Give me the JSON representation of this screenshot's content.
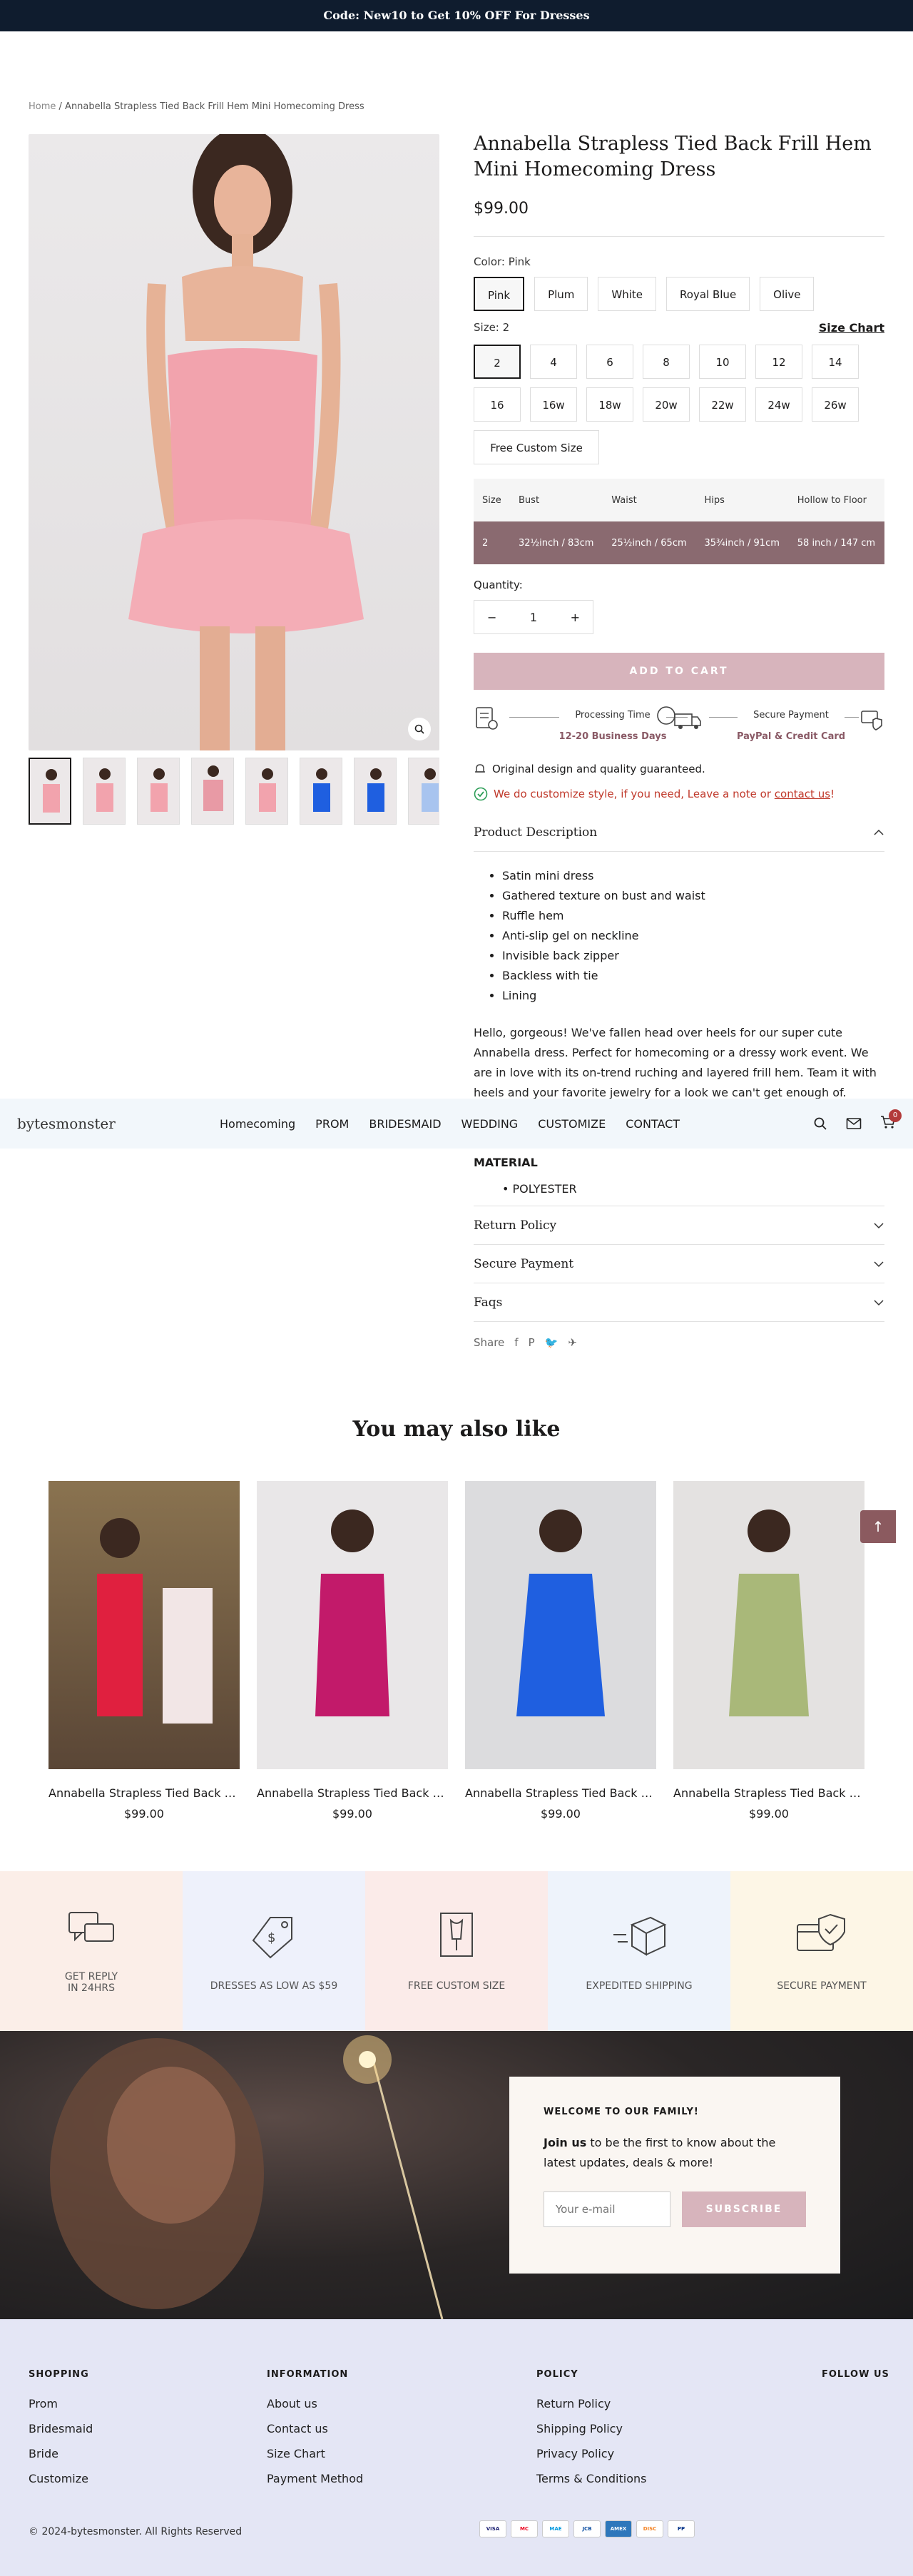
{
  "announcement": "Code: New10 to Get 10% OFF For Dresses",
  "breadcrumb": {
    "home": "Home",
    "sep": " / ",
    "current": "Annabella Strapless Tied Back Frill Hem Mini Homecoming Dress"
  },
  "product": {
    "title": "Annabella Strapless Tied Back Frill Hem Mini Homecoming Dress",
    "price": "$99.00",
    "color_label": "Color:",
    "color_value": "Pink",
    "colors": [
      "Pink",
      "Plum",
      "White",
      "Royal Blue",
      "Olive"
    ],
    "size_label": "Size:",
    "size_value": "2",
    "size_chart": "Size Chart",
    "sizes": [
      "2",
      "4",
      "6",
      "8",
      "10",
      "12",
      "14",
      "16",
      "16w",
      "18w",
      "20w",
      "22w",
      "24w",
      "26w",
      "Free Custom Size"
    ],
    "table_headers": [
      "Size",
      "Bust",
      "Waist",
      "Hips",
      "Hollow to Floor"
    ],
    "table_row": [
      "2",
      "32½inch / 83cm",
      "25½inch / 65cm",
      "35¾inch / 91cm",
      "58 inch / 147 cm"
    ],
    "quantity_label": "Quantity:",
    "quantity": "1",
    "add_to_cart": "ADD TO CART",
    "processing_label": "Processing Time",
    "processing_value": "12-20 Business Days",
    "payment_label": "Secure Payment",
    "payment_value": "PayPal & Credit Card",
    "note1": "Original design and quality guaranteed.",
    "note2_pre": "We do customize style, if you need, Leave a note or ",
    "note2_link": "contact us",
    "note2_post": "!",
    "desc_heading": "Product Description",
    "features": [
      "Satin mini dress",
      "Gathered texture on bust and waist",
      "Ruffle hem",
      "Anti-slip gel on neckline",
      "Invisible back zipper",
      "Backless with tie",
      "Lining"
    ],
    "description": "Hello, gorgeous! We've fallen head over heels for our super cute Annabella dress. Perfect for homecoming or a dressy work event. We are in love with its on-trend ruching and layered frill hem. Team it with heels and your favorite jewelry for a look we can't get enough of.",
    "material_heading": "MATERIAL",
    "material": "POLYESTER",
    "accordions": [
      "Return Policy",
      "Secure Payment",
      "Faqs"
    ],
    "share_label": "Share"
  },
  "nav": {
    "logo": "bytesmonster",
    "items": [
      "Homecoming",
      "PROM",
      "BRIDESMAID",
      "WEDDING",
      "CUSTOMIZE",
      "CONTACT"
    ],
    "cart_count": "0"
  },
  "related": {
    "heading": "You may also like",
    "items": [
      {
        "name": "Annabella Strapless Tied Back Frill Hem Mini Homecoming Dress",
        "price": "$99.00",
        "color": "#e0203f"
      },
      {
        "name": "Annabella Strapless Tied Back Frill Hem Mini Homecoming Dress",
        "price": "$99.00",
        "color": "#c21a6a"
      },
      {
        "name": "Annabella Strapless Tied Back Frill Hem Mini Homecoming Dress",
        "price": "$99.00",
        "color": "#1f5fe0"
      },
      {
        "name": "Annabella Strapless Tied Back Frill Hem Mini Homecoming Dress",
        "price": "$99.00",
        "color": "#a9b879"
      }
    ]
  },
  "features_bar": [
    {
      "label": "GET REPLY\nIN 24HRS",
      "bg": "#fbeee8",
      "icon": "chat-icon"
    },
    {
      "label": "DRESSES AS LOW AS $59",
      "bg": "#eef1fb",
      "icon": "price-tag-icon"
    },
    {
      "label": "FREE CUSTOM SIZE",
      "bg": "#fbebe9",
      "icon": "dress-form-icon"
    },
    {
      "label": "EXPEDITED SHIPPING",
      "bg": "#eef3fb",
      "icon": "box-icon"
    },
    {
      "label": "SECURE PAYMENT",
      "bg": "#fdf6e6",
      "icon": "shield-card-icon"
    }
  ],
  "newsletter": {
    "title": "WELCOME TO OUR FAMILY!",
    "text_bold": "Join us",
    "text": " to be the first to know about the latest updates, deals & more!",
    "placeholder": "Your e-mail",
    "button": "SUBSCRIBE"
  },
  "footer": {
    "shopping_h": "SHOPPING",
    "shopping": [
      "Prom",
      "Bridesmaid",
      "Bride",
      "Customize"
    ],
    "info_h": "INFORMATION",
    "info": [
      "About us",
      "Contact us",
      "Size Chart",
      "Payment Method"
    ],
    "policy_h": "POLICY",
    "policy": [
      "Return Policy",
      "Shipping Policy",
      "Privacy Policy",
      "Terms & Conditions"
    ],
    "follow_h": "FOLLOW US",
    "copyright": "© 2024-bytesmonster. All Rights Reserved",
    "payments": [
      "VISA",
      "MC",
      "MAE",
      "JCB",
      "AMEX",
      "DISC",
      "PP"
    ]
  },
  "colors": {
    "accent": "#d7b4bc",
    "table_row": "#8a6a70",
    "announcement_bg": "#0f1c2e",
    "nav_bg": "#f2f7fb",
    "footer_bg": "#e4e6f5"
  }
}
